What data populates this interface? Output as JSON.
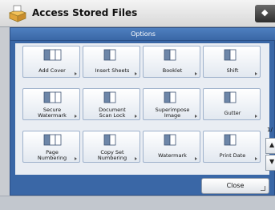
{
  "window": {
    "title": "Access Stored Files",
    "title_icon": "folder-box-icon",
    "right_button_icon": "device-icon"
  },
  "panel": {
    "header": "Options",
    "page_indicator": "1/",
    "close_label": "Close"
  },
  "tiles": [
    {
      "label1": "Add Cover",
      "label2": "",
      "icon": "add-cover-icon"
    },
    {
      "label1": "Insert Sheets",
      "label2": "",
      "icon": "insert-sheets-icon"
    },
    {
      "label1": "Booklet",
      "label2": "",
      "icon": "booklet-icon"
    },
    {
      "label1": "Shift",
      "label2": "",
      "icon": "shift-icon"
    },
    {
      "label1": "Secure",
      "label2": "Watermark",
      "icon": "secure-watermark-icon"
    },
    {
      "label1": "Document",
      "label2": "Scan Lock",
      "icon": "document-scan-lock-icon"
    },
    {
      "label1": "Superimpose",
      "label2": "Image",
      "icon": "superimpose-image-icon"
    },
    {
      "label1": "Gutter",
      "label2": "",
      "icon": "gutter-icon"
    },
    {
      "label1": "Page",
      "label2": "Numbering",
      "icon": "page-numbering-icon"
    },
    {
      "label1": "Copy Set",
      "label2": "Numbering",
      "icon": "copy-set-numbering-icon"
    },
    {
      "label1": "Watermark",
      "label2": "",
      "icon": "watermark-icon"
    },
    {
      "label1": "Print Date",
      "label2": "",
      "icon": "print-date-icon"
    }
  ]
}
